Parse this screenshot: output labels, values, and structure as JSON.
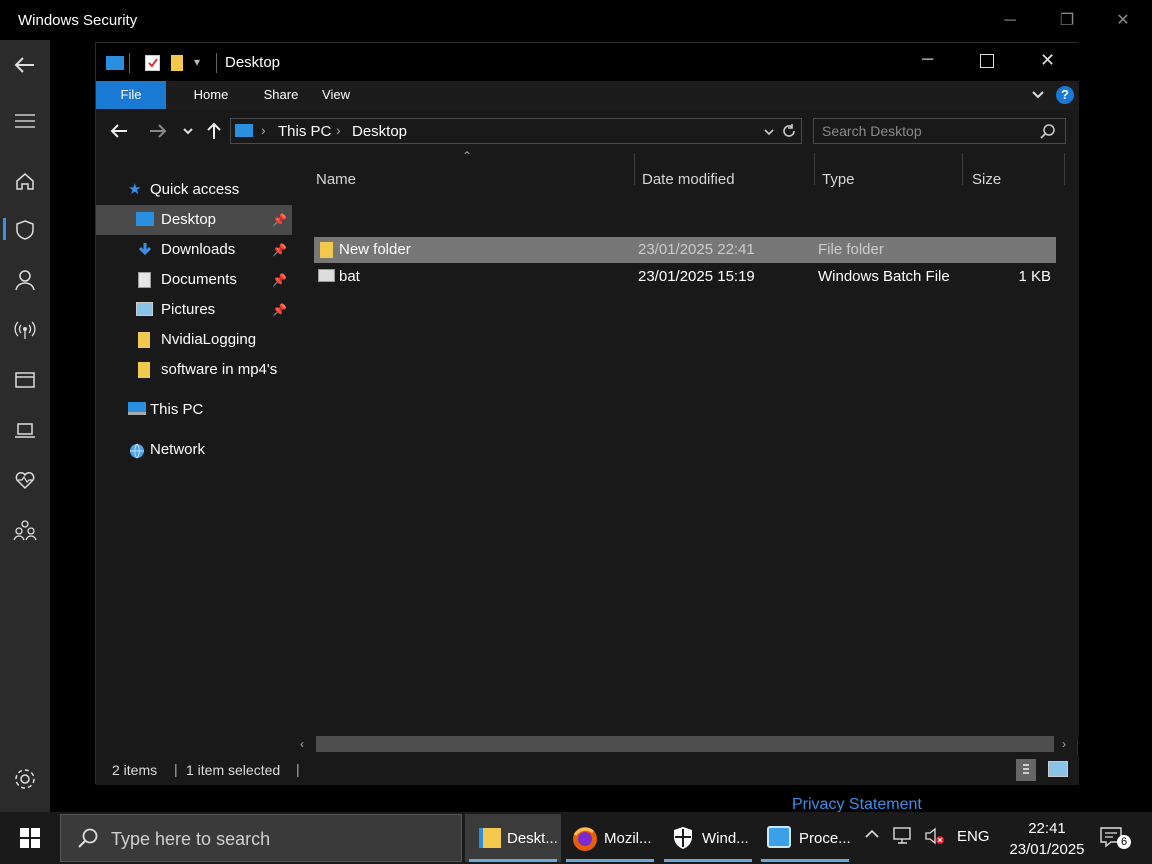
{
  "outer_window": {
    "title": "Windows Security",
    "privacy_link": "Privacy Statement",
    "nav_icons": [
      "back-arrow-icon",
      "hamburger-menu-icon",
      "home-icon",
      "shield-icon",
      "account-icon",
      "wireless-icon",
      "app-browser-icon",
      "device-icon",
      "heart-health-icon",
      "family-icon",
      "settings-gear-icon"
    ]
  },
  "explorer": {
    "title": "Desktop",
    "ribbon_tabs": [
      "File",
      "Home",
      "Share",
      "View"
    ],
    "breadcrumb": [
      "This PC",
      "Desktop"
    ],
    "search_placeholder": "Search Desktop",
    "nav": {
      "quick_access": "Quick access",
      "items": [
        {
          "label": "Desktop",
          "icon": "desktop-folder-icon",
          "pinned": true,
          "selected": true
        },
        {
          "label": "Downloads",
          "icon": "downloads-folder-icon",
          "pinned": true
        },
        {
          "label": "Documents",
          "icon": "documents-folder-icon",
          "pinned": true
        },
        {
          "label": "Pictures",
          "icon": "pictures-folder-icon",
          "pinned": true
        },
        {
          "label": "NvidiaLogging",
          "icon": "folder-icon",
          "pinned": false
        },
        {
          "label": "software in mp4's",
          "icon": "folder-icon",
          "pinned": false
        }
      ],
      "this_pc": "This PC",
      "network": "Network"
    },
    "columns": [
      "Name",
      "Date modified",
      "Type",
      "Size"
    ],
    "files": [
      {
        "name": "New folder",
        "date": "23/01/2025 22:41",
        "type": "File folder",
        "size": "",
        "icon": "folder-icon",
        "selected": true
      },
      {
        "name": "bat",
        "date": "23/01/2025 15:19",
        "type": "Windows Batch File",
        "size": "1 KB",
        "icon": "batch-file-icon",
        "selected": false
      }
    ],
    "status": {
      "items": "2 items",
      "selected": "1 item selected"
    }
  },
  "taskbar": {
    "search_placeholder": "Type here to search",
    "apps": [
      {
        "label": "Deskt...",
        "icon": "file-explorer-icon",
        "active": true
      },
      {
        "label": "Mozil...",
        "icon": "firefox-icon",
        "active": false
      },
      {
        "label": "Wind...",
        "icon": "windows-security-icon",
        "active": false
      },
      {
        "label": "Proce...",
        "icon": "process-monitor-icon",
        "active": false
      }
    ],
    "language": "ENG",
    "time": "22:41",
    "date": "23/01/2025",
    "notifications": "6"
  },
  "colors": {
    "accent": "#1979d3",
    "selected_row": "#777777",
    "link": "#3a8fe6",
    "folder": "#f2c94c"
  }
}
